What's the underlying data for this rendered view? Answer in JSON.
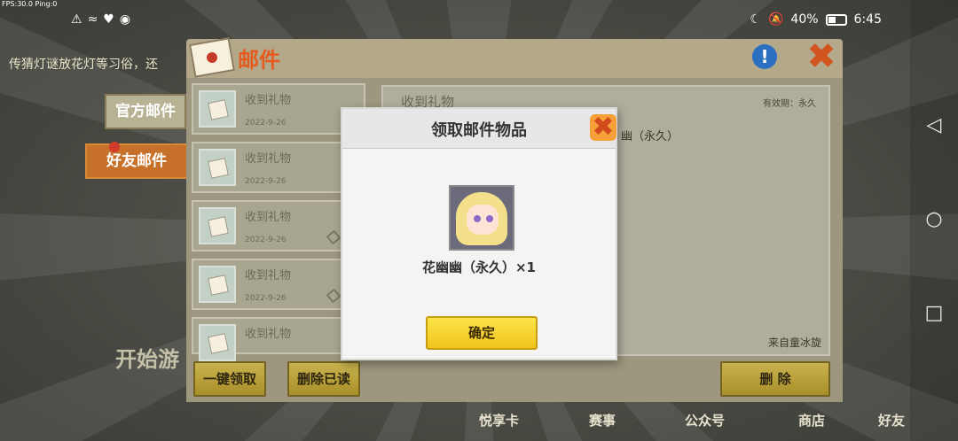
{
  "status_bar": {
    "fps_text": "FPS:30.0  Ping:0",
    "battery_percent": "40%",
    "time": "6:45"
  },
  "mail": {
    "title": "邮件",
    "info_icon": "info-icon",
    "tabs": [
      "官方邮件",
      "好友邮件"
    ],
    "active_tab": "好友邮件",
    "items": [
      {
        "title": "收到礼物",
        "date": "2022-9-26"
      },
      {
        "title": "收到礼物",
        "date": "2022-9-26"
      },
      {
        "title": "收到礼物",
        "date": "2022-9-26"
      },
      {
        "title": "收到礼物",
        "date": "2022-9-26"
      },
      {
        "title": "收到礼物",
        "date": ""
      }
    ],
    "detail": {
      "title": "收到礼物",
      "validity": "有效期：永久",
      "item_text": "幽（永久）",
      "from": "来自童冰旋"
    },
    "buttons": {
      "claim_all": "一键领取",
      "delete_read": "删除已读",
      "delete": "删 除"
    }
  },
  "background": {
    "ticker": "传猜灯谜放花灯等习俗，还",
    "start_game": "开始游",
    "bottom_nav": [
      "悦享卡",
      "赛事",
      "公众号",
      "商店",
      "好友"
    ]
  },
  "dialog": {
    "title": "领取邮件物品",
    "reward_name": "花幽幽（永久）×1",
    "confirm": "确定"
  },
  "colors": {
    "accent_orange": "#e55a1f",
    "confirm_yellow": "#f0c41d"
  }
}
